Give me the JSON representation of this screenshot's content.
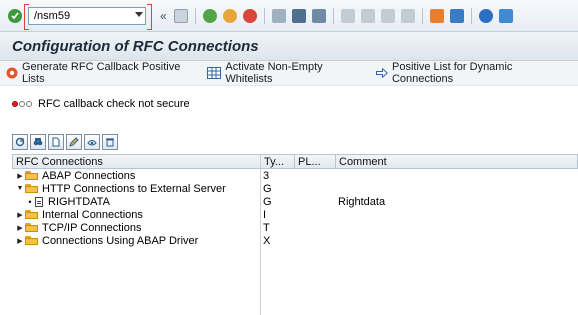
{
  "system_toolbar": {
    "command_field": "/nsm59",
    "icons": [
      "enter-icon",
      "back-icon",
      "exit-icon",
      "cancel-icon",
      "print-icon",
      "find-icon",
      "find-next-icon",
      "first-page-icon",
      "previous-page-icon",
      "next-page-icon",
      "last-page-icon",
      "new-session-icon",
      "shortcut-icon",
      "help-icon",
      "customize-icon"
    ]
  },
  "title": "Configuration of RFC Connections",
  "app_toolbar": {
    "generate_label": "Generate RFC Callback Positive Lists",
    "activate_label": "Activate Non-Empty Whitelists",
    "positive_list_label": "Positive List for Dynamic Connections"
  },
  "status": {
    "text": "RFC callback check not secure",
    "light_colors": [
      "#dd2222",
      "#f4f4f4",
      "#f4f4f4"
    ]
  },
  "tree": {
    "headers": {
      "name": "RFC Connections",
      "type": "Ty...",
      "pl": "PL...",
      "comment": "Comment"
    },
    "rows": [
      {
        "name": "ABAP Connections",
        "type": "3",
        "comment": ""
      },
      {
        "name": "HTTP Connections to External Server",
        "type": "G",
        "comment": ""
      },
      {
        "name": "RIGHTDATA",
        "type": "G",
        "comment": "Rightdata"
      },
      {
        "name": "Internal Connections",
        "type": "I",
        "comment": ""
      },
      {
        "name": "TCP/IP Connections",
        "type": "T",
        "comment": ""
      },
      {
        "name": "Connections Using ABAP Driver",
        "type": "X",
        "comment": ""
      }
    ]
  },
  "colors": {
    "title_text": "#1c2b3a",
    "folder": "#f4c24b",
    "ok_button": "#3c9b3c"
  }
}
